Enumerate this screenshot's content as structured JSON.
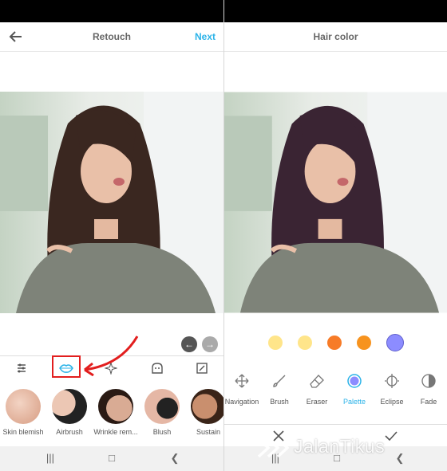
{
  "left": {
    "title": "Retouch",
    "next_label": "Next",
    "categories": [
      "adjust-icon",
      "lips-icon",
      "sparkle-icon",
      "face-icon",
      "frame-icon"
    ],
    "tools": [
      {
        "label": "Skin blemish",
        "icon": "skin-blemish-thumb"
      },
      {
        "label": "Airbrush",
        "icon": "airbrush-thumb"
      },
      {
        "label": "Wrinkle rem...",
        "icon": "wrinkle-remover-thumb"
      },
      {
        "label": "Blush",
        "icon": "blush-thumb"
      },
      {
        "label": "Sustain",
        "icon": "sustain-thumb"
      }
    ]
  },
  "right": {
    "title": "Hair color",
    "swatches": [
      "#ffe58a",
      "#ffe58a",
      "#f77b27",
      "#f7931e",
      "#8c8cff"
    ],
    "tools": [
      {
        "label": "Navigation",
        "icon": "move-icon"
      },
      {
        "label": "Brush",
        "icon": "brush-icon"
      },
      {
        "label": "Eraser",
        "icon": "eraser-icon"
      },
      {
        "label": "Palette",
        "icon": "palette-icon"
      },
      {
        "label": "Eclipse",
        "icon": "eclipse-icon"
      },
      {
        "label": "Fade",
        "icon": "fade-icon"
      }
    ]
  },
  "watermark": "JalanTikus",
  "colors": {
    "accent": "#2bb3e8",
    "highlight": "#e21e1e",
    "palette_selected": "#8c8cff"
  }
}
